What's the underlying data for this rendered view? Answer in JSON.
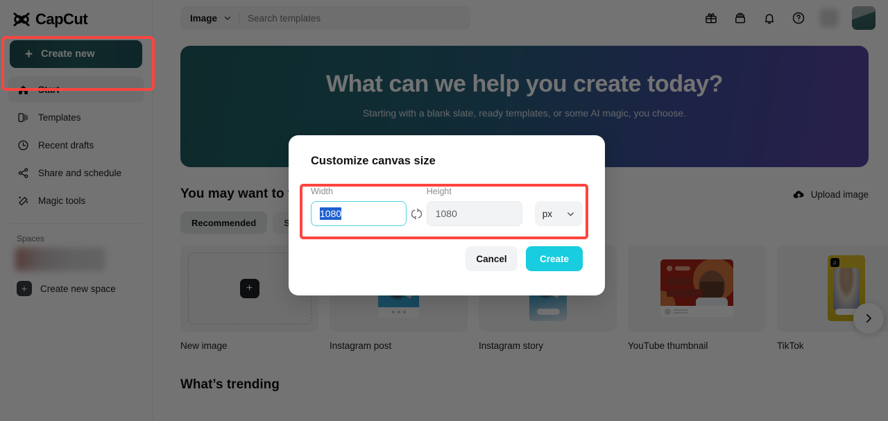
{
  "brand": {
    "name": "CapCut",
    "logo_icon": "capcut-logo-icon"
  },
  "sidebar": {
    "create_new": {
      "label": "Create new",
      "icon": "plus-icon"
    },
    "items": [
      {
        "label": "Start",
        "icon": "home-icon",
        "active": true
      },
      {
        "label": "Templates",
        "icon": "templates-icon",
        "active": false
      },
      {
        "label": "Recent drafts",
        "icon": "clock-icon",
        "active": false
      },
      {
        "label": "Share and schedule",
        "icon": "share-icon",
        "active": false
      },
      {
        "label": "Magic tools",
        "icon": "magic-wand-icon",
        "active": false
      }
    ],
    "spaces_label": "Spaces",
    "create_space": {
      "label": "Create new space",
      "icon": "plus-icon"
    }
  },
  "topbar": {
    "search": {
      "scope": "Image",
      "scope_chevron": "chevron-down-icon",
      "placeholder": "Search templates",
      "value": ""
    },
    "icons": [
      {
        "name": "gift-icon"
      },
      {
        "name": "archive-box-icon"
      },
      {
        "name": "bell-icon"
      },
      {
        "name": "help-circle-icon"
      }
    ],
    "avatar": "user-avatar"
  },
  "hero": {
    "title": "What can we help you create today?",
    "subtitle": "Starting with a blank slate, ready templates, or some AI magic, you choose.",
    "gradient_from": "#1f5b5f",
    "gradient_to": "#5a47a8"
  },
  "main": {
    "section_title": "You may want to try",
    "upload": {
      "label": "Upload image",
      "icon": "cloud-upload-icon"
    },
    "chips": [
      {
        "label": "Recommended",
        "active": true
      },
      {
        "label": "Social media",
        "active": false
      }
    ],
    "cards": [
      {
        "label": "New image",
        "kind": "new"
      },
      {
        "label": "Instagram post",
        "kind": "ig-post"
      },
      {
        "label": "Instagram story",
        "kind": "ig-story"
      },
      {
        "label": "YouTube thumbnail",
        "kind": "yt"
      },
      {
        "label": "TikTok",
        "kind": "tiktok"
      }
    ],
    "carousel_next_icon": "chevron-right-icon",
    "trending_title": "What’s trending"
  },
  "modal": {
    "title": "Customize canvas size",
    "width": {
      "label": "Width",
      "value": "1080",
      "focused": true,
      "selected": true
    },
    "height": {
      "label": "Height",
      "value": "1080",
      "focused": false
    },
    "swap_icon": "swap-vertical-icon",
    "unit": {
      "value": "px",
      "chevron": "chevron-down-icon"
    },
    "cancel": "Cancel",
    "create": "Create",
    "accent_color": "#18cde0",
    "focus_border_color": "#4fd4e4"
  },
  "annotations": {
    "highlight_color": "#fd453f",
    "boxes": [
      {
        "name": "create-new-highlight"
      },
      {
        "name": "canvas-size-fields-highlight"
      }
    ]
  }
}
